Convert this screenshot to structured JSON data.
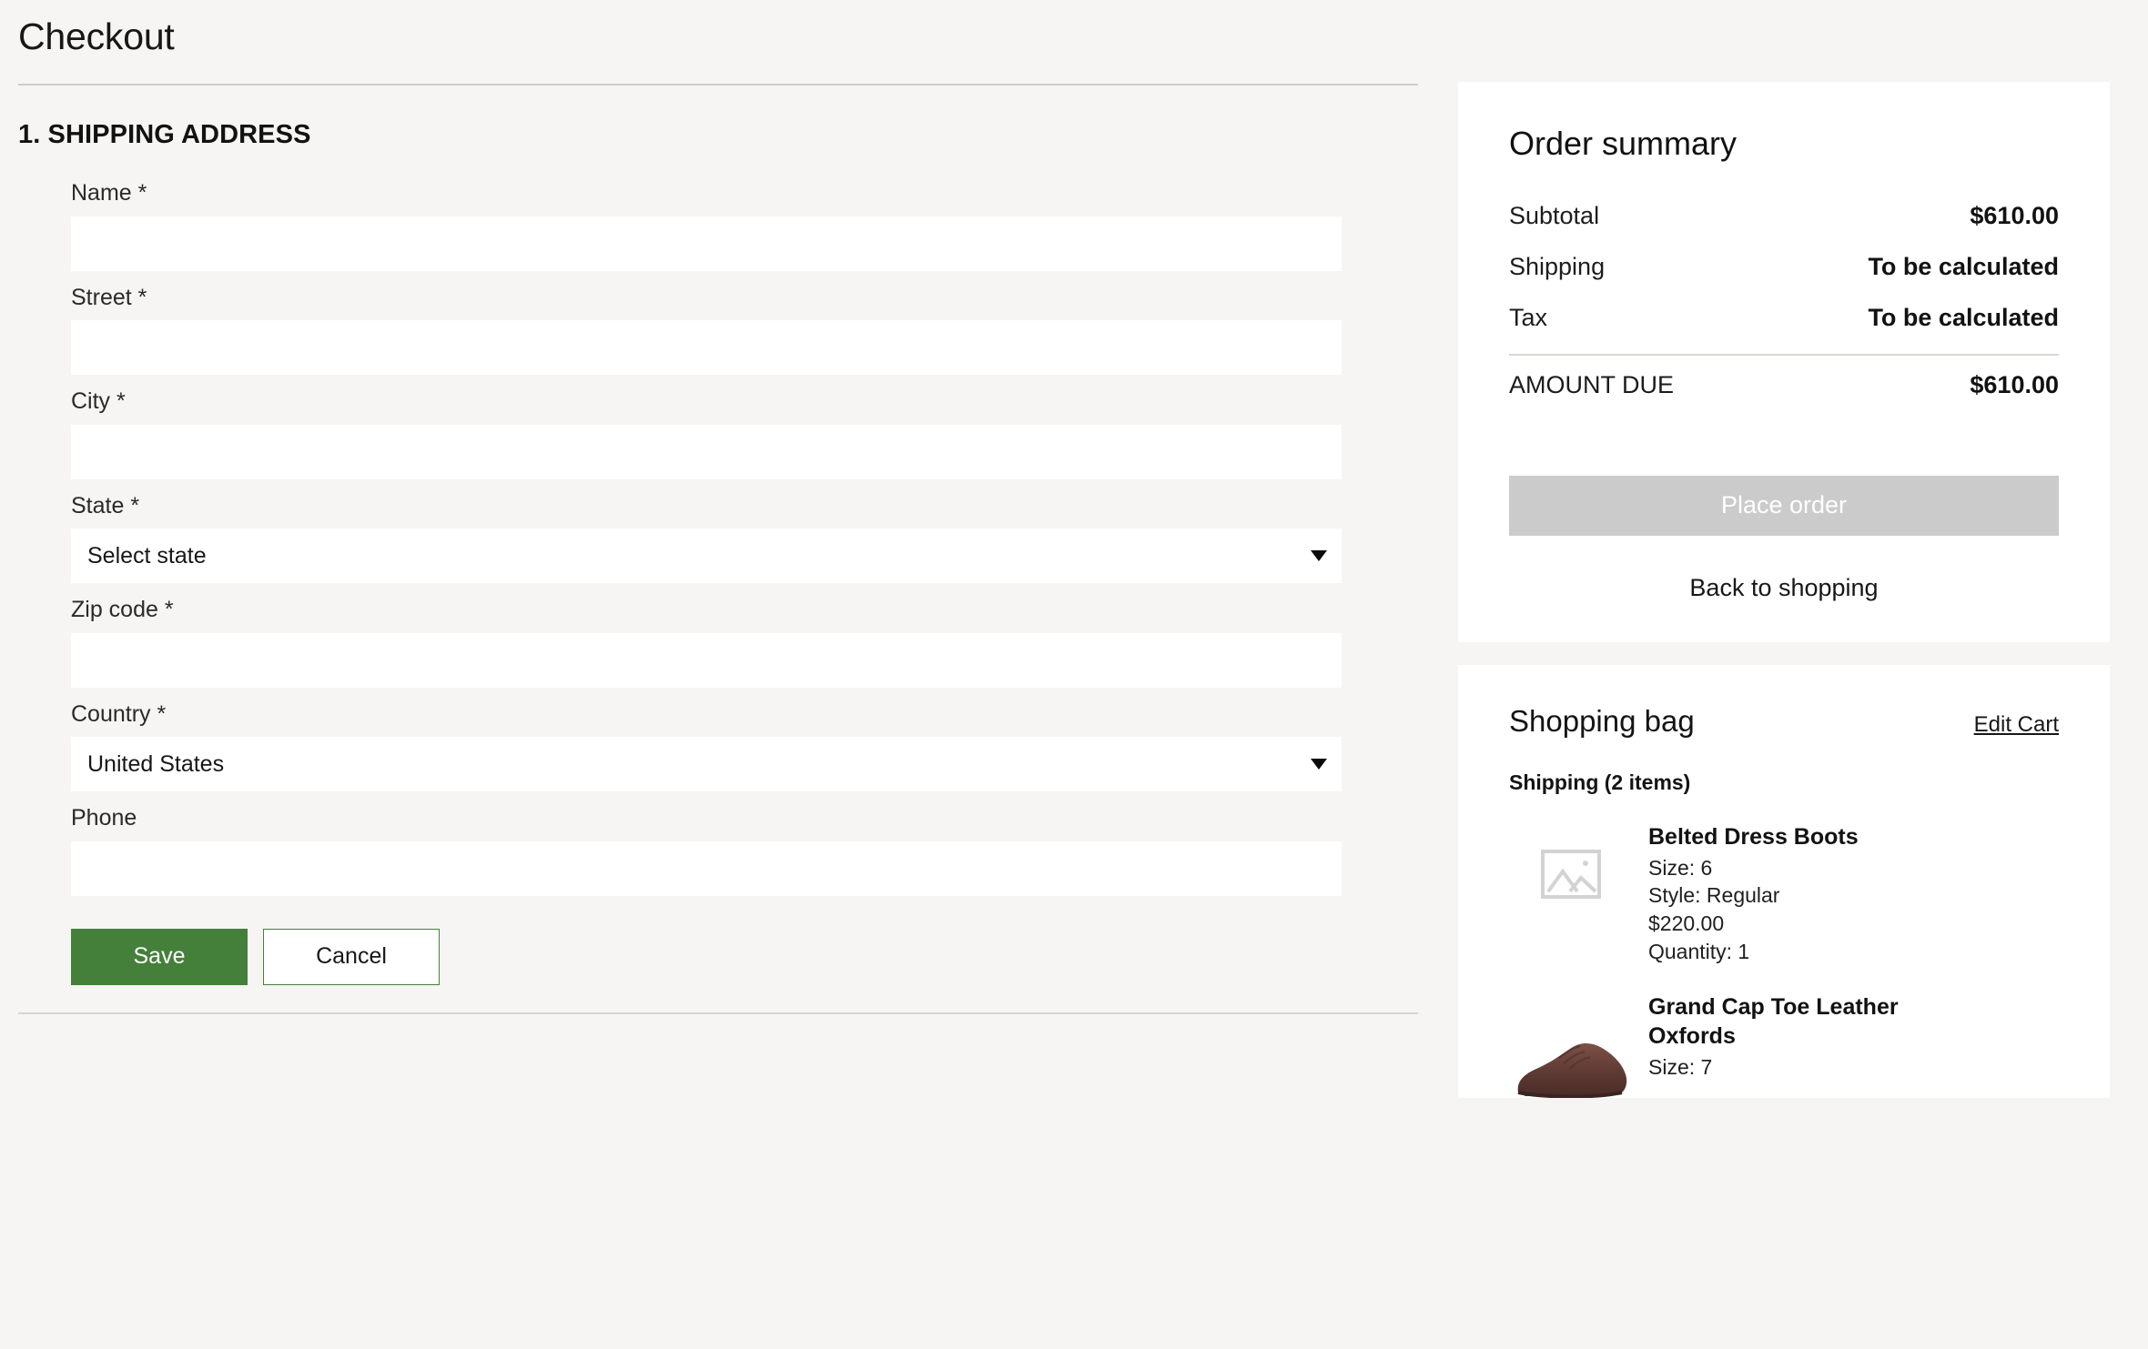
{
  "header": {
    "title": "Checkout"
  },
  "shipping_section": {
    "heading": "1. SHIPPING ADDRESS",
    "fields": [
      {
        "label": "Name *",
        "value": "",
        "placeholder": "",
        "type": "text"
      },
      {
        "label": "Street *",
        "value": "",
        "placeholder": "",
        "type": "text"
      },
      {
        "label": "City *",
        "value": "",
        "placeholder": "",
        "type": "text"
      },
      {
        "label": "State *",
        "value": "Select state",
        "type": "select"
      },
      {
        "label": "Zip code *",
        "value": "",
        "placeholder": "",
        "type": "text"
      },
      {
        "label": "Country *",
        "value": "United States",
        "type": "select"
      },
      {
        "label": "Phone",
        "value": "",
        "placeholder": "",
        "type": "text"
      }
    ],
    "save_label": "Save",
    "cancel_label": "Cancel"
  },
  "order_summary": {
    "title": "Order summary",
    "rows": [
      {
        "label": "Subtotal",
        "value": "$610.00"
      },
      {
        "label": "Shipping",
        "value": "To be calculated"
      },
      {
        "label": "Tax",
        "value": "To be calculated"
      }
    ],
    "amount_due_label": "AMOUNT DUE",
    "amount_due_value": "$610.00",
    "place_order_label": "Place order",
    "back_to_shopping_label": "Back to shopping"
  },
  "shopping_bag": {
    "title": "Shopping bag",
    "edit_cart_label": "Edit Cart",
    "shipping_group_label": "Shipping (2 items)",
    "items": [
      {
        "name": "Belted Dress Boots",
        "size": "Size: 6",
        "style": "Style: Regular",
        "price": "$220.00",
        "quantity": "Quantity: 1",
        "thumb": "placeholder-image-icon"
      },
      {
        "name": "Grand Cap Toe Leather Oxfords",
        "size": "Size: 7",
        "style": "",
        "price": "",
        "quantity": "",
        "thumb": "brown-oxford-shoe-photo"
      }
    ]
  },
  "colors": {
    "page_background": "#f6f5f3",
    "card_background": "#ffffff",
    "accent_green": "#44803a",
    "disabled_gray": "#cbcbcb",
    "rule_gray": "#cfcdca"
  }
}
